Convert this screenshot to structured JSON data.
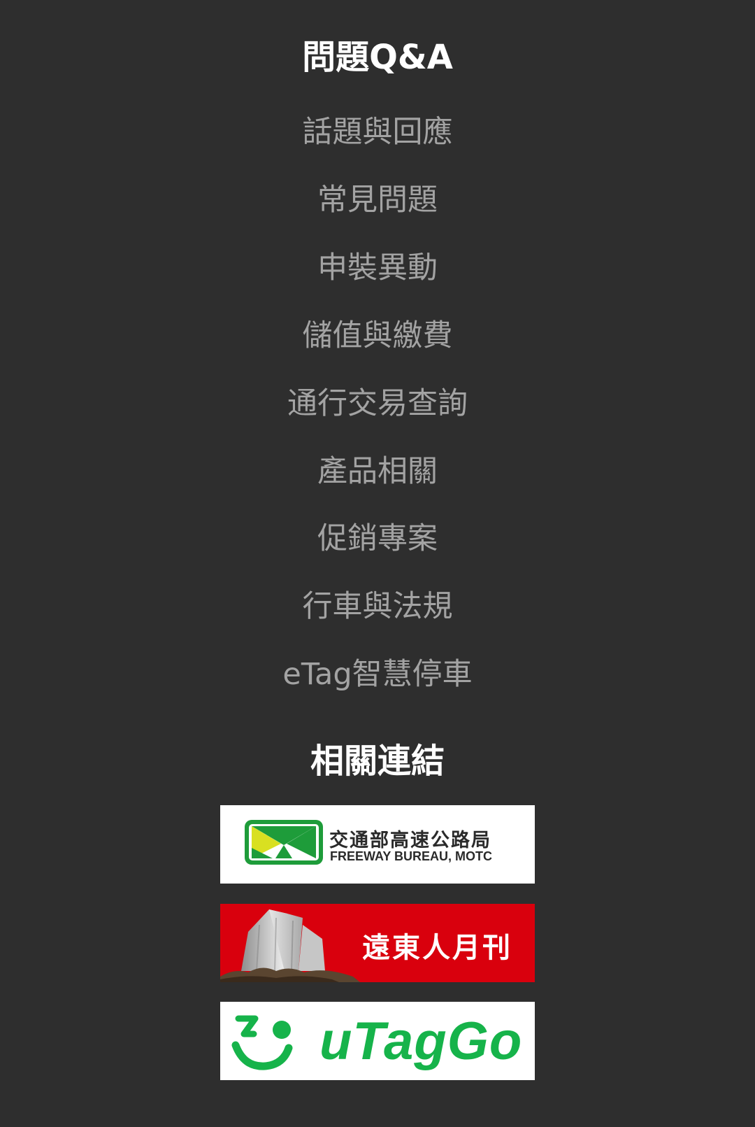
{
  "qa_section": {
    "title": "問題Q&A",
    "items": [
      "話題與回應",
      "常見問題",
      "申裝異動",
      "儲值與繳費",
      "通行交易查詢",
      "產品相關",
      "促銷專案",
      "行車與法規",
      "eTag智慧停車"
    ]
  },
  "links_section": {
    "title": "相關連結",
    "banners": {
      "freeway": {
        "zh": "交通部高速公路局",
        "en": "FREEWAY BUREAU, MOTC",
        "icon": "freeway-bureau-logo-icon"
      },
      "fareast": {
        "text": "遠東人月刊",
        "icon": "building-icon"
      },
      "utaggo": {
        "text": "uTagGo",
        "icon": "utaggo-logo-icon"
      }
    }
  },
  "colors": {
    "background": "#2e2e2e",
    "title": "#ffffff",
    "link": "#a3a3a3",
    "fareast_red": "#d9000d",
    "utaggo_green": "#16b34a",
    "freeway_green": "#1e9c3a",
    "freeway_yellow": "#d9e021"
  }
}
